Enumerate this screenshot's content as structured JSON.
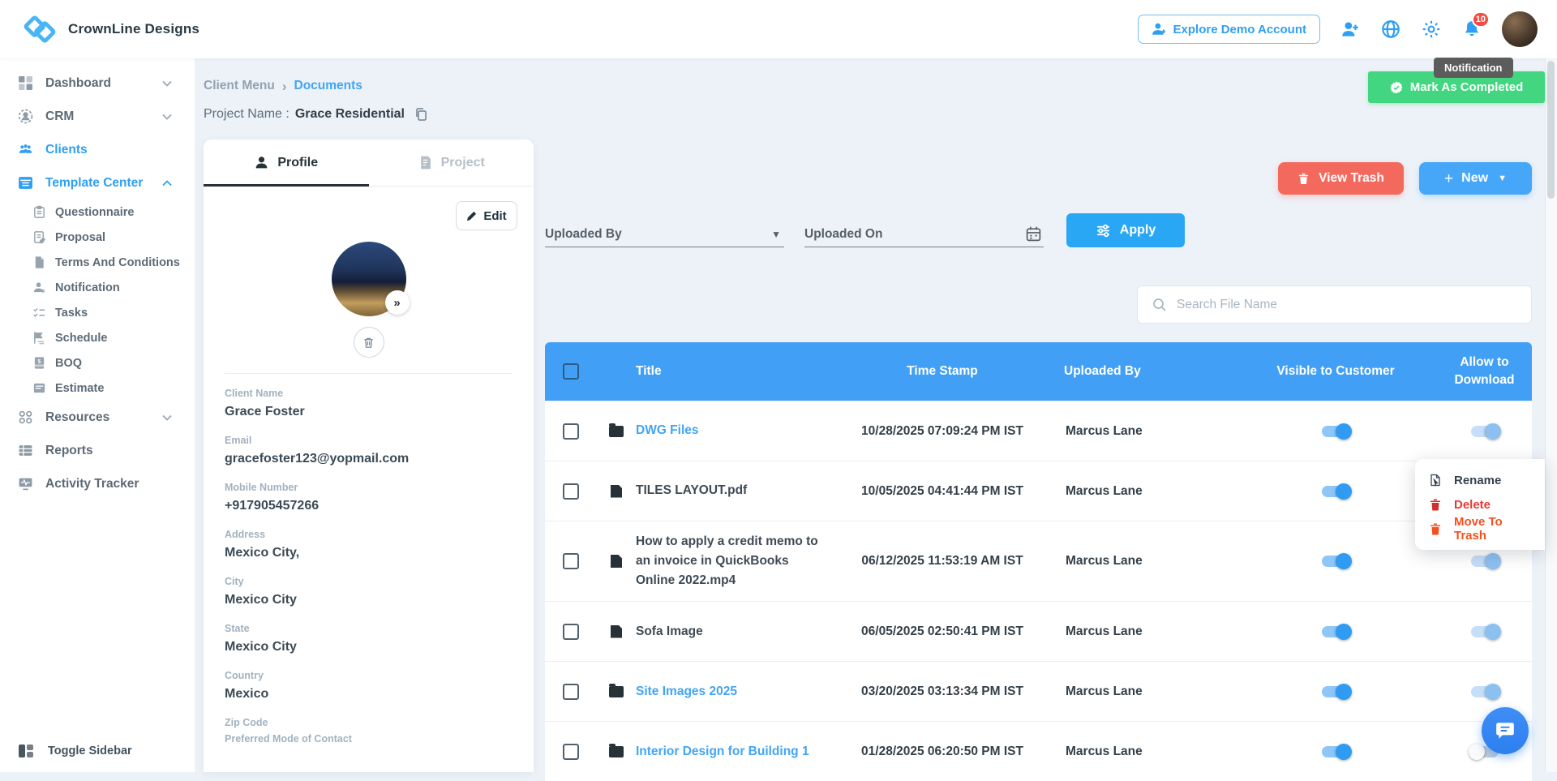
{
  "header": {
    "brand": "CrownLine Designs",
    "explore_label": "Explore Demo Account",
    "badge_count": "10"
  },
  "overlays": {
    "tooltip": "Notification",
    "mark_completed": "Mark As Completed"
  },
  "sidebar": {
    "items": [
      {
        "label": "Dashboard"
      },
      {
        "label": "CRM"
      },
      {
        "label": "Clients"
      },
      {
        "label": "Template Center"
      },
      {
        "label": "Questionnaire"
      },
      {
        "label": "Proposal"
      },
      {
        "label": "Terms And Conditions"
      },
      {
        "label": "Notification"
      },
      {
        "label": "Tasks"
      },
      {
        "label": "Schedule"
      },
      {
        "label": "BOQ"
      },
      {
        "label": "Estimate"
      },
      {
        "label": "Resources"
      },
      {
        "label": "Reports"
      },
      {
        "label": "Activity Tracker"
      }
    ],
    "toggle_label": "Toggle Sidebar"
  },
  "breadcrumb": {
    "parent": "Client Menu",
    "current": "Documents"
  },
  "project": {
    "label": "Project Name :",
    "name": "Grace Residential"
  },
  "panel": {
    "tab_profile": "Profile",
    "tab_project": "Project",
    "edit_label": "Edit",
    "expand_glyph": "»",
    "fields": [
      {
        "label": "Client Name",
        "value": "Grace Foster"
      },
      {
        "label": "Email",
        "value": "gracefoster123@yopmail.com"
      },
      {
        "label": "Mobile Number",
        "value": "+917905457266"
      },
      {
        "label": "Address",
        "value": "Mexico City,"
      },
      {
        "label": "City",
        "value": "Mexico City"
      },
      {
        "label": "State",
        "value": "Mexico City"
      },
      {
        "label": "Country",
        "value": "Mexico"
      },
      {
        "label": "Zip Code",
        "value": ""
      },
      {
        "label": "Preferred Mode of Contact",
        "value": ""
      }
    ]
  },
  "toolbar": {
    "view_trash": "View Trash",
    "new_label": "New",
    "uploaded_by": "Uploaded By",
    "uploaded_on": "Uploaded On",
    "apply": "Apply",
    "search_placeholder": "Search File Name"
  },
  "table": {
    "headers": {
      "title": "Title",
      "timestamp": "Time Stamp",
      "uploaded_by": "Uploaded By",
      "visible": "Visible to Customer",
      "allow": "Allow to Download"
    },
    "rows": [
      {
        "title": "DWG Files",
        "timestamp": "10/28/2025 07:09:24 PM IST",
        "uploaded_by": "Marcus Lane",
        "folder": true,
        "link": true,
        "visible_on": true,
        "allow_on": true
      },
      {
        "title": "TILES LAYOUT.pdf",
        "timestamp": "10/05/2025 04:41:44 PM IST",
        "uploaded_by": "Marcus Lane",
        "folder": false,
        "link": false,
        "visible_on": true,
        "allow_on": true
      },
      {
        "title": "How to apply a credit memo to an invoice in QuickBooks Online 2022.mp4",
        "timestamp": "06/12/2025 11:53:19 AM IST",
        "uploaded_by": "Marcus Lane",
        "folder": false,
        "link": false,
        "visible_on": true,
        "allow_on": true
      },
      {
        "title": "Sofa Image",
        "timestamp": "06/05/2025 02:50:41 PM IST",
        "uploaded_by": "Marcus Lane",
        "folder": false,
        "link": false,
        "visible_on": true,
        "allow_on": true
      },
      {
        "title": "Site Images 2025",
        "timestamp": "03/20/2025 03:13:34 PM IST",
        "uploaded_by": "Marcus Lane",
        "folder": true,
        "link": true,
        "visible_on": true,
        "allow_on": true
      },
      {
        "title": "Interior Design for Building 1",
        "timestamp": "01/28/2025 06:20:50 PM IST",
        "uploaded_by": "Marcus Lane",
        "folder": true,
        "link": true,
        "visible_on": true,
        "allow_on": false
      }
    ]
  },
  "context_menu": {
    "items": [
      {
        "label": "Rename"
      },
      {
        "label": "Delete"
      },
      {
        "label": "Move To Trash"
      }
    ]
  },
  "colors": {
    "primary": "#3fa2f7",
    "table_header": "#41a0f5",
    "link": "#42a5f5",
    "danger": "#f4695e",
    "success": "#41d67f",
    "menu_delete": "#e53935",
    "menu_move": "#f4511e"
  }
}
